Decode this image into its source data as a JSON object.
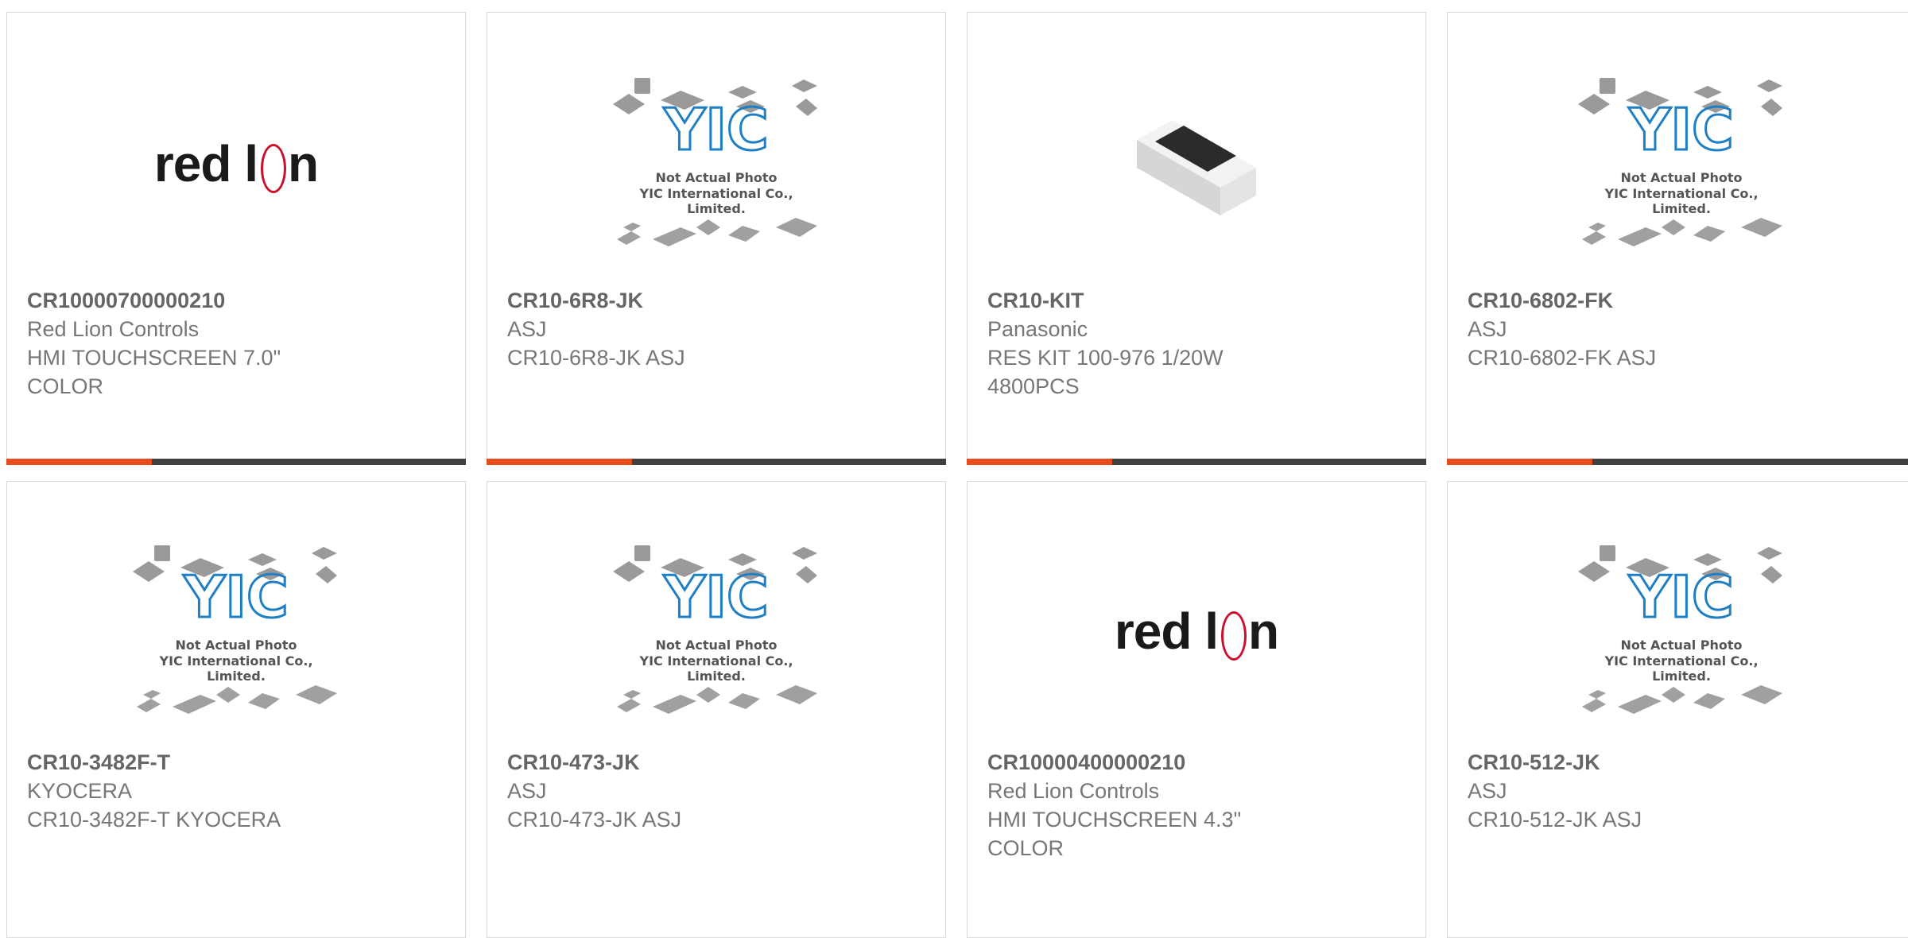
{
  "products": [
    {
      "part": "CR10000700000210",
      "mfr": "Red Lion Controls",
      "desc": "HMI TOUCHSCREEN 7.0\" COLOR",
      "image": "red-lion-logo"
    },
    {
      "part": "CR10-6R8-JK",
      "mfr": "ASJ",
      "desc": "CR10-6R8-JK ASJ",
      "image": "yic-placeholder"
    },
    {
      "part": "CR10-KIT",
      "mfr": "Panasonic",
      "desc": "RES KIT 100-976 1/20W 4800PCS",
      "image": "resistor-chip"
    },
    {
      "part": "CR10-6802-FK",
      "mfr": "ASJ",
      "desc": "CR10-6802-FK ASJ",
      "image": "yic-placeholder"
    },
    {
      "part": "CR10-3482F-T",
      "mfr": "KYOCERA",
      "desc": "CR10-3482F-T KYOCERA",
      "image": "yic-placeholder"
    },
    {
      "part": "CR10-473-JK",
      "mfr": "ASJ",
      "desc": "CR10-473-JK ASJ",
      "image": "yic-placeholder"
    },
    {
      "part": "CR10000400000210",
      "mfr": "Red Lion Controls",
      "desc": "HMI TOUCHSCREEN 4.3\" COLOR",
      "image": "red-lion-logo"
    },
    {
      "part": "CR10-512-JK",
      "mfr": "ASJ",
      "desc": "CR10-512-JK ASJ",
      "image": "yic-placeholder"
    }
  ],
  "logo": {
    "red_lion_left": "red l",
    "red_lion_right": "n"
  },
  "placeholder": {
    "line1": "Not Actual Photo",
    "line2": "YIC International Co., Limited.",
    "brand": "YIC"
  },
  "colors": {
    "accent": "#e84b1c",
    "bar": "#3f3f3f",
    "yic_blue": "#1f7fc4",
    "red_lion": "#c8102e"
  }
}
